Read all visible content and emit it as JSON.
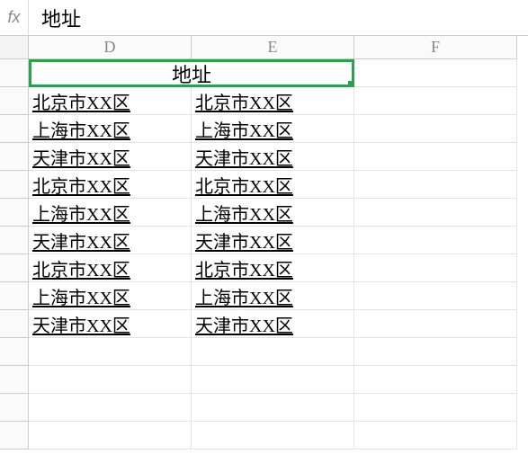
{
  "formula_bar": {
    "fx_label": "fx",
    "value": "地址"
  },
  "columns": {
    "D": "D",
    "E": "E",
    "F": "F"
  },
  "merged_header": "地址",
  "data": {
    "D": [
      "北京市XX区",
      "上海市XX区",
      "天津市XX区",
      "北京市XX区",
      "上海市XX区",
      "天津市XX区",
      "北京市XX区",
      "上海市XX区",
      "天津市XX区"
    ],
    "E": [
      "北京市XX区",
      "上海市XX区",
      "天津市XX区",
      "北京市XX区",
      "上海市XX区",
      "天津市XX区",
      "北京市XX区",
      "上海市XX区",
      "天津市XX区"
    ]
  },
  "empty_rows": 4
}
